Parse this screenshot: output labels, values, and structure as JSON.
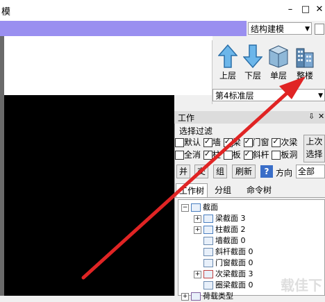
{
  "window": {
    "title": "模",
    "min": "–",
    "restore": "□",
    "close": "✕"
  },
  "mode_select": {
    "value": "结构建模"
  },
  "floor_buttons": [
    {
      "label": "上层",
      "icon": "arrow-up-icon"
    },
    {
      "label": "下层",
      "icon": "arrow-down-icon"
    },
    {
      "label": "单层",
      "icon": "single-floor-icon"
    },
    {
      "label": "整楼",
      "icon": "whole-building-icon"
    }
  ],
  "floor_select": {
    "value": "第4标准层"
  },
  "work_panel": {
    "title": "工作",
    "pin": "⇩",
    "close": "✕",
    "filter_label": "选择过滤",
    "filters_row1": [
      {
        "label": "默认",
        "checked": false
      },
      {
        "label": "墙",
        "checked": true
      },
      {
        "label": "梁",
        "checked": true
      },
      {
        "label": "门窗",
        "checked": true
      },
      {
        "label": "次梁",
        "checked": true
      }
    ],
    "filters_row2": [
      {
        "label": "全消",
        "checked": false
      },
      {
        "label": "柱",
        "checked": true
      },
      {
        "label": "板",
        "checked": false
      },
      {
        "label": "斜杆",
        "checked": true
      },
      {
        "label": "板洞",
        "checked": false
      }
    ],
    "last_select": "上次选择",
    "toolbar": [
      "并",
      "交",
      "组",
      "刷新"
    ],
    "help": "?",
    "direction_label": "方向",
    "direction_value": "全部",
    "tabs": [
      "工作树",
      "分组",
      "命令树"
    ],
    "tree": [
      {
        "label": "截面",
        "level": 0,
        "expander": "−"
      },
      {
        "label": "梁截面 3",
        "level": 1,
        "expander": "+"
      },
      {
        "label": "柱截面 2",
        "level": 1,
        "expander": "+"
      },
      {
        "label": "墙截面 0",
        "level": 1,
        "expander": ""
      },
      {
        "label": "斜杆截面 0",
        "level": 1,
        "expander": ""
      },
      {
        "label": "门窗截面 0",
        "level": 1,
        "expander": ""
      },
      {
        "label": "次梁截面 3",
        "level": 1,
        "expander": "+"
      },
      {
        "label": "圈梁截面 0",
        "level": 1,
        "expander": ""
      },
      {
        "label": "荷载类型",
        "level": 0,
        "expander": "+"
      }
    ]
  },
  "watermark": "载佳下"
}
